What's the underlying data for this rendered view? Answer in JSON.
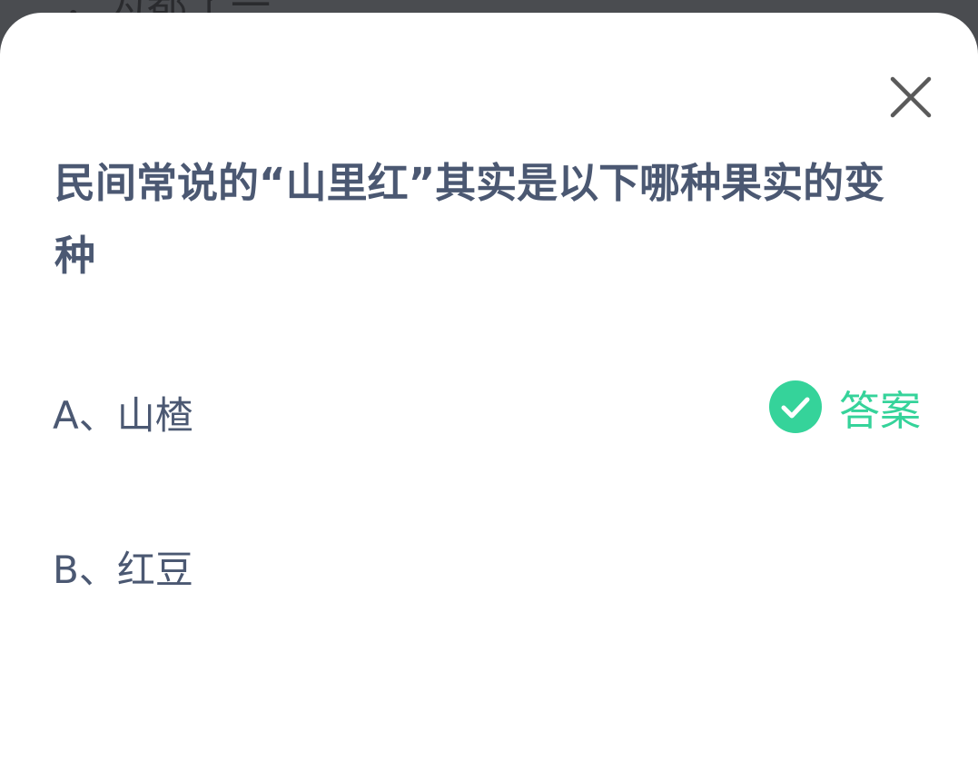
{
  "backdrop": {
    "partial_text": "，为都了一…"
  },
  "dialog": {
    "question": "民间常说的“山里红”其实是以下哪种果实的变种",
    "options": [
      {
        "label": "A、山楂",
        "is_answer": true
      },
      {
        "label": "B、红豆",
        "is_answer": false
      }
    ],
    "answer_label": "答案",
    "colors": {
      "text": "#4b5872",
      "answer_green": "#35d39a",
      "close_icon": "#5a5a5a"
    },
    "icons": {
      "close": "close-icon",
      "answer": "check-circle-icon"
    }
  }
}
